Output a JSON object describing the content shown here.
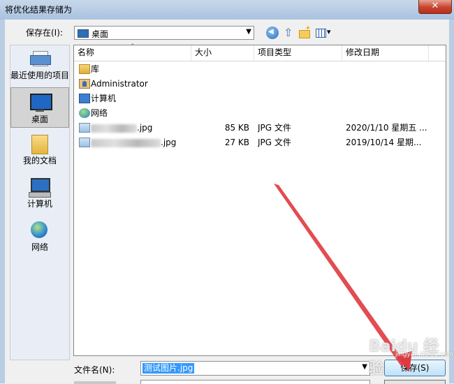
{
  "window": {
    "title": "将优化结果存储为",
    "close_glyph": "✕"
  },
  "save_in": {
    "label": "保存在(I):",
    "value": "桌面"
  },
  "places": [
    {
      "label": "最近使用的项目",
      "icon": "recent-items-icon"
    },
    {
      "label": "桌面",
      "icon": "desktop-icon",
      "selected": true
    },
    {
      "label": "我的文档",
      "icon": "documents-icon"
    },
    {
      "label": "计算机",
      "icon": "computer-icon"
    },
    {
      "label": "网络",
      "icon": "network-icon"
    }
  ],
  "columns": {
    "name": "名称",
    "size": "大小",
    "type": "项目类型",
    "date": "修改日期"
  },
  "files": [
    {
      "name": "库",
      "size": "",
      "type": "",
      "date": "",
      "icon": "library-icon"
    },
    {
      "name": "Administrator",
      "size": "",
      "type": "",
      "date": "",
      "icon": "user-folder-icon"
    },
    {
      "name": "计算机",
      "size": "",
      "type": "",
      "date": "",
      "icon": "computer-icon"
    },
    {
      "name": "网络",
      "size": "",
      "type": "",
      "date": "",
      "icon": "network-icon"
    },
    {
      "name_suffix": ".jpg",
      "size": "85 KB",
      "type": "JPG 文件",
      "date": "2020/1/10 星期五 ...",
      "icon": "jpg-file-icon"
    },
    {
      "name_suffix": ".jpg",
      "size": "27 KB",
      "type": "JPG 文件",
      "date": "2019/10/14 星期...",
      "icon": "jpg-file-icon"
    }
  ],
  "filename": {
    "label": "文件名(N):",
    "value": "测试图片.jpg"
  },
  "buttons": {
    "save": "保存(S)"
  },
  "watermark": {
    "text": "Baidu 经验",
    "sub": "jingyan.baidu.com"
  },
  "colors": {
    "arrow": "#e0393e",
    "selection": "#3399ff"
  }
}
